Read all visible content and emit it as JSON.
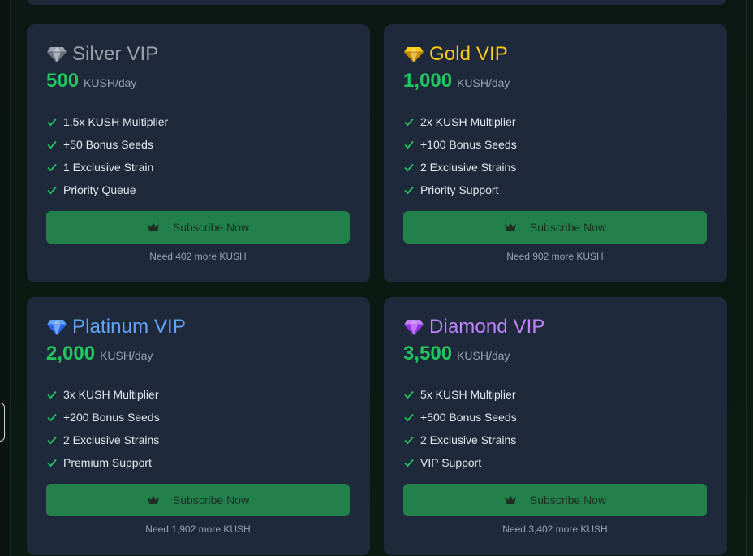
{
  "plans": [
    {
      "name": "Silver VIP",
      "price": "500",
      "unit": "KUSH/day",
      "features": [
        "1.5x KUSH Multiplier",
        "+50 Bonus Seeds",
        "1 Exclusive Strain",
        "Priority Queue"
      ],
      "button_label": "Subscribe Now",
      "need_text": "Need 402 more KUSH",
      "name_color": "#9ca3af",
      "gem_icon": "silver-diamond-icon"
    },
    {
      "name": "Gold VIP",
      "price": "1,000",
      "unit": "KUSH/day",
      "features": [
        "2x KUSH Multiplier",
        "+100 Bonus Seeds",
        "2 Exclusive Strains",
        "Priority Support"
      ],
      "button_label": "Subscribe Now",
      "need_text": "Need 902 more KUSH",
      "name_color": "#facc15",
      "gem_icon": "gold-diamond-icon"
    },
    {
      "name": "Platinum VIP",
      "price": "2,000",
      "unit": "KUSH/day",
      "features": [
        "3x KUSH Multiplier",
        "+200 Bonus Seeds",
        "2 Exclusive Strains",
        "Premium Support"
      ],
      "button_label": "Subscribe Now",
      "need_text": "Need 1,902 more KUSH",
      "name_color": "#60a5fa",
      "gem_icon": "platinum-diamond-icon"
    },
    {
      "name": "Diamond VIP",
      "price": "3,500",
      "unit": "KUSH/day",
      "features": [
        "5x KUSH Multiplier",
        "+500 Bonus Seeds",
        "2 Exclusive Strains",
        "VIP Support"
      ],
      "button_label": "Subscribe Now",
      "need_text": "Need 3,402 more KUSH",
      "name_color": "#c084fc",
      "gem_icon": "diamond-icon"
    }
  ],
  "colors": {
    "price": "#22c55e",
    "check": "#22c55e",
    "button_bg": "#22804a",
    "card_bg": "#1e293b"
  }
}
